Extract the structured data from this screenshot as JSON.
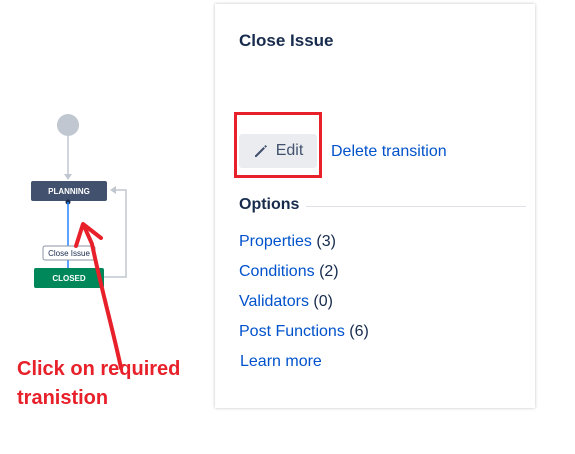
{
  "diagram": {
    "planning_label": "PLANNING",
    "closed_label": "CLOSED",
    "transition_label": "Close Issue"
  },
  "panel": {
    "title": "Close Issue",
    "edit_label": "Edit",
    "delete_label": "Delete transition",
    "options_heading": "Options",
    "options": [
      {
        "label": "Properties",
        "count": "(3)"
      },
      {
        "label": "Conditions",
        "count": "(2)"
      },
      {
        "label": "Validators",
        "count": "(0)"
      },
      {
        "label": "Post Functions",
        "count": "(6)"
      }
    ],
    "learn_more": "Learn more"
  },
  "annotation": {
    "line1": "Click on required",
    "line2": "tranistion"
  },
  "colors": {
    "planning_bg": "#42526e",
    "closed_bg": "#00875a",
    "annotation_red": "#e8202a",
    "link_blue": "#0052cc"
  }
}
